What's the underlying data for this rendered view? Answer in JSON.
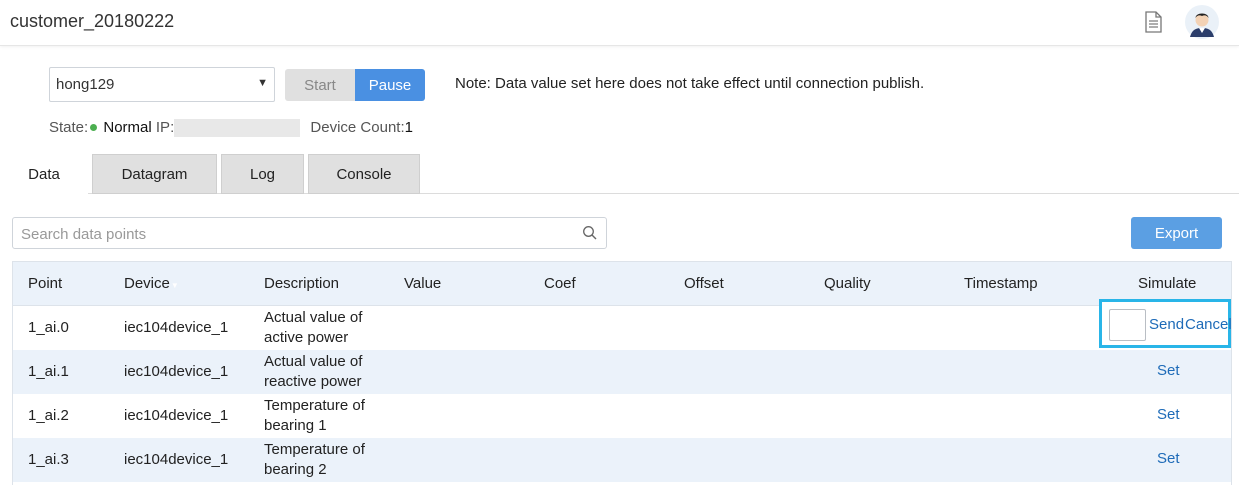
{
  "header": {
    "title": "customer_20180222",
    "doc_icon": "document-icon",
    "avatar_icon": "user-avatar-icon"
  },
  "controls": {
    "connection_value": "hong129",
    "start_label": "Start",
    "pause_label": "Pause",
    "note": "Note: Data value set here does not take effect until connection publish."
  },
  "status": {
    "state_label": "State:",
    "state_value": "Normal",
    "ip_label": "IP:",
    "device_count_label": "Device Count:",
    "device_count_value": "1",
    "state_color": "#4caf50"
  },
  "tabs": [
    {
      "label": "Data",
      "active": true
    },
    {
      "label": "Datagram",
      "active": false
    },
    {
      "label": "Log",
      "active": false
    },
    {
      "label": "Console",
      "active": false
    }
  ],
  "search": {
    "placeholder": "Search data points",
    "icon": "search-icon"
  },
  "export_label": "Export",
  "table": {
    "columns": [
      "Point",
      "Device",
      "Description",
      "Value",
      "Coef",
      "Offset",
      "Quality",
      "Timestamp",
      "Simulate"
    ],
    "rows": [
      {
        "point": "1_ai.0",
        "device": "iec104device_1",
        "desc1": "Actual value of",
        "desc2": "active power",
        "send": "Send",
        "cancel": "Cancel"
      },
      {
        "point": "1_ai.1",
        "device": "iec104device_1",
        "desc1": "Actual value of",
        "desc2": "reactive power",
        "action": "Set"
      },
      {
        "point": "1_ai.2",
        "device": "iec104device_1",
        "desc1": "Temperature of",
        "desc2": "bearing 1",
        "action": "Set"
      },
      {
        "point": "1_ai.3",
        "device": "iec104device_1",
        "desc1": "Temperature of",
        "desc2": "bearing 2",
        "action": "Set"
      }
    ]
  },
  "colors": {
    "accent": "#4a90e2",
    "link": "#1e6bb8",
    "highlight": "#29b5e8",
    "row_alt": "#ebf2fa"
  }
}
